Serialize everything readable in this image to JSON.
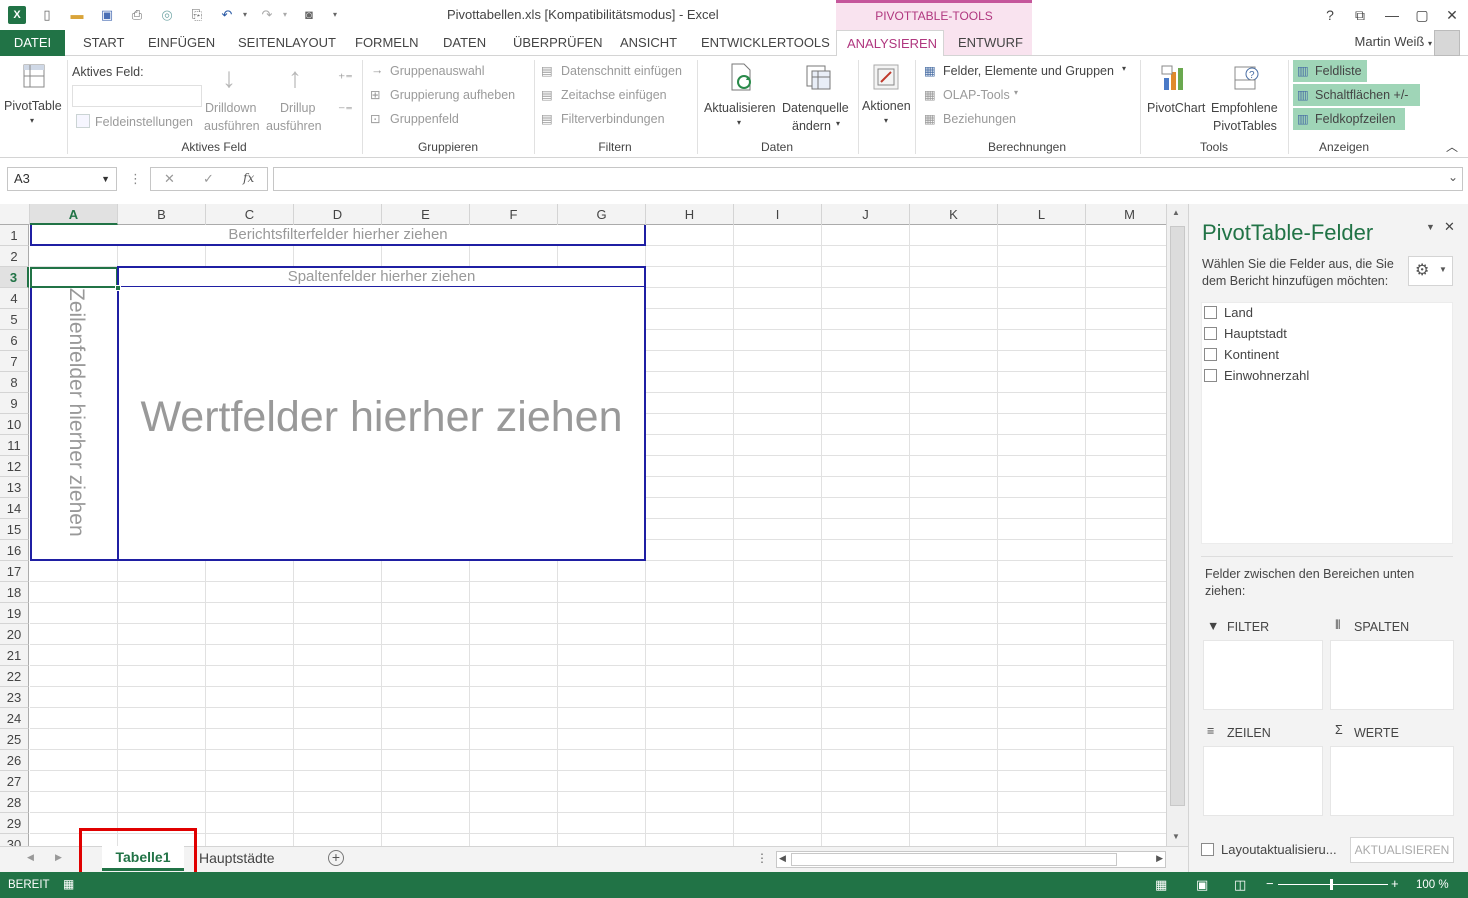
{
  "window": {
    "title": "Pivottabellen.xls  [Kompatibilitätsmodus] - Excel",
    "help": "?",
    "minimize": "—",
    "close": "✕",
    "restore": "⧉"
  },
  "quick_access": {
    "logo": "X"
  },
  "context_header": "PIVOTTABLE-TOOLS",
  "tabs": [
    "DATEI",
    "START",
    "EINFÜGEN",
    "SEITENLAYOUT",
    "FORMELN",
    "DATEN",
    "ÜBERPRÜFEN",
    "ANSICHT",
    "ENTWICKLERTOOLS",
    "ANALYSIEREN",
    "ENTWURF"
  ],
  "user": "Martin Weiß",
  "ribbon": {
    "pivottable": "PivotTable",
    "active_field_label": "Aktives Feld:",
    "field_settings": "Feldeinstellungen",
    "drilldown": [
      "Drilldown",
      "ausführen"
    ],
    "drillup": [
      "Drillup",
      "ausführen"
    ],
    "group_active_field": "Aktives Feld",
    "group_selection": "Gruppenauswahl",
    "ungroup": "Gruppierung aufheben",
    "group_field": "Gruppenfeld",
    "group_grouping": "Gruppieren",
    "insert_slicer": "Datenschnitt einfügen",
    "insert_timeline": "Zeitachse einfügen",
    "filter_connections": "Filterverbindungen",
    "group_filter": "Filtern",
    "refresh": "Aktualisieren",
    "change_source": [
      "Datenquelle",
      "ändern"
    ],
    "group_data": "Daten",
    "actions": "Aktionen",
    "fields_items_sets": "Felder, Elemente und Gruppen",
    "olap_tools": "OLAP-Tools",
    "relationships": "Beziehungen",
    "group_calculations": "Berechnungen",
    "pivotchart": "PivotChart",
    "recommended": [
      "Empfohlene",
      "PivotTables"
    ],
    "group_tools": "Tools",
    "field_list": "Feldliste",
    "buttons_pm": "Schaltflächen +/-",
    "field_headers": "Feldkopfzeilen",
    "group_show": "Anzeigen"
  },
  "formula_bar": {
    "name_box": "A3",
    "fx": "fx",
    "cancel": "✕",
    "enter": "✓"
  },
  "columns": [
    "A",
    "B",
    "C",
    "D",
    "E",
    "F",
    "G",
    "H",
    "I",
    "J",
    "K",
    "L",
    "M"
  ],
  "rows": [
    "1",
    "2",
    "3",
    "4",
    "5",
    "6",
    "7",
    "8",
    "9",
    "10",
    "11",
    "12",
    "13",
    "14",
    "15",
    "16",
    "17",
    "18",
    "19",
    "20",
    "21",
    "22",
    "23",
    "24",
    "25",
    "26",
    "27",
    "28",
    "29",
    "30"
  ],
  "pivot_placeholders": {
    "report_filter": "Berichtsfilterfelder hierher ziehen",
    "column_fields": "Spaltenfelder hierher ziehen",
    "row_fields": "Zeilenfelder hierher ziehen",
    "value_fields": "Wertfelder hierher ziehen"
  },
  "pivot_panel": {
    "title": "PivotTable-Felder",
    "instruction": "Wählen Sie die Felder aus, die Sie dem Bericht hinzufügen möchten:",
    "fields": [
      "Land",
      "Hauptstadt",
      "Kontinent",
      "Einwohnerzahl"
    ],
    "areas_instruction": "Felder zwischen den Bereichen unten ziehen:",
    "areas": {
      "filter": "FILTER",
      "columns": "SPALTEN",
      "rows": "ZEILEN",
      "values": "WERTE"
    },
    "defer_update": "Layoutaktualisieru...",
    "update_button": "AKTUALISIEREN"
  },
  "sheet_tabs": [
    "Tabelle1",
    "Hauptstädte"
  ],
  "status": {
    "mode": "BEREIT",
    "zoom": "100 %"
  },
  "colors": {
    "excel_green": "#217346",
    "context_pink": "#b0377f",
    "pivot_border": "#1f1fa3",
    "highlight_red": "#e00000"
  }
}
